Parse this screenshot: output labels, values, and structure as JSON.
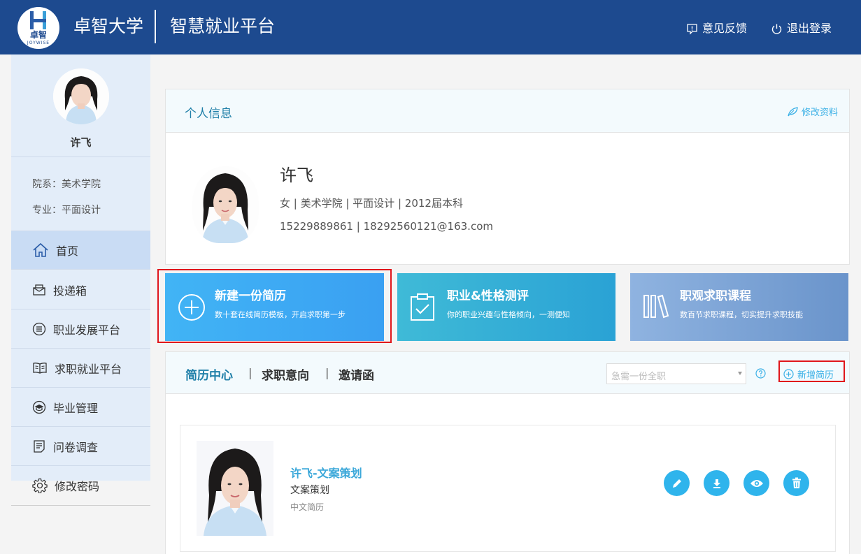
{
  "header": {
    "logo_text": "卓智",
    "logo_sub": "JOYWISE",
    "school_name": "卓智大学",
    "platform_name": "智慧就业平台",
    "feedback_label": "意见反馈",
    "logout_label": "退出登录"
  },
  "sidebar": {
    "user_name": "许飞",
    "department": "院系：美术学院",
    "major": "专业：平面设计",
    "items": [
      {
        "label": "首页",
        "icon": "home-icon"
      },
      {
        "label": "投递箱",
        "icon": "inbox-icon"
      },
      {
        "label": "职业发展平台",
        "icon": "list-icon"
      },
      {
        "label": "求职就业平台",
        "icon": "book-icon"
      },
      {
        "label": "毕业管理",
        "icon": "graduation-cap-icon"
      },
      {
        "label": "问卷调查",
        "icon": "survey-icon"
      },
      {
        "label": "修改密码",
        "icon": "gear-icon"
      }
    ]
  },
  "profile": {
    "section_title": "个人信息",
    "edit_label": "修改资料",
    "name": "许飞",
    "meta": "女 | 美术学院 | 平面设计 | 2012届本科",
    "contact": "15229889861 | 18292560121@163.com"
  },
  "tiles": [
    {
      "title": "新建一份简历",
      "subtitle": "数十套在线简历模板，开启求职第一步",
      "icon": "plus-circle-icon"
    },
    {
      "title": "职业&性格测评",
      "subtitle": "你的职业兴趣与性格倾向，一测便知",
      "icon": "clipboard-check-icon"
    },
    {
      "title": "职观求职课程",
      "subtitle": "数百节求职课程，切实提升求职技能",
      "icon": "books-icon"
    }
  ],
  "resume_center": {
    "tabs": [
      "简历中心",
      "求职意向",
      "邀请函"
    ],
    "separator": "|",
    "select_placeholder": "急需一份全职",
    "add_label": "新增简历",
    "resume": {
      "title": "许飞-文案策划",
      "job": "文案策划",
      "language": "中文简历"
    }
  },
  "colors": {
    "header_bg": "#1d4a8f",
    "accent": "#2fb4ec",
    "highlight_frame": "#e0161b"
  }
}
